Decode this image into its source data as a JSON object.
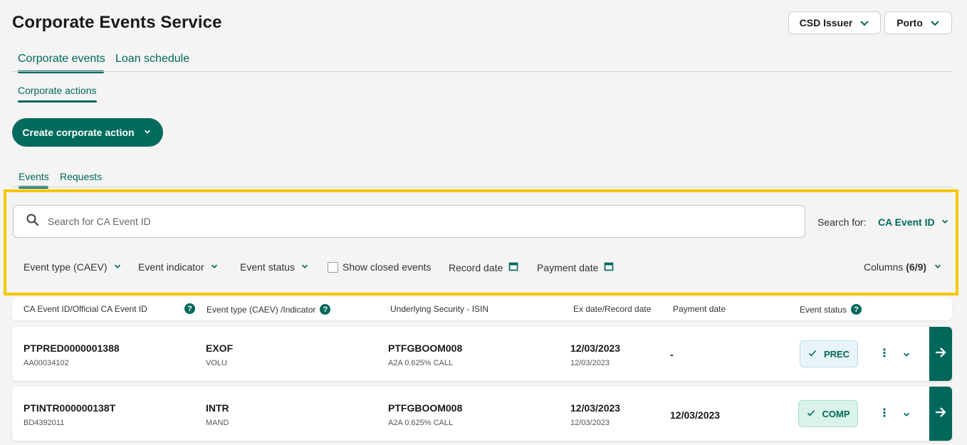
{
  "header": {
    "title": "Corporate Events Service",
    "role_selector": "CSD Issuer",
    "location_selector": "Porto"
  },
  "main_tabs": [
    {
      "label": "Corporate events",
      "active": true
    },
    {
      "label": "Loan schedule",
      "active": false
    }
  ],
  "sub_tab": {
    "label": "Corporate actions",
    "active": true
  },
  "create_button": "Create corporate action",
  "content_tabs": [
    {
      "label": "Events",
      "active": true
    },
    {
      "label": "Requests",
      "active": false
    }
  ],
  "search": {
    "placeholder": "Search for CA Event ID",
    "search_for_label": "Search for:",
    "search_for_value": "CA Event ID"
  },
  "filters": {
    "event_type": "Event type (CAEV)",
    "event_indicator": "Event indicator",
    "event_status": "Event status",
    "show_closed": "Show closed events",
    "record_date": "Record date",
    "payment_date": "Payment date",
    "columns_label": "Columns",
    "columns_count": "(6/9)"
  },
  "table": {
    "headers": {
      "id": "CA Event ID/Official CA Event ID",
      "type": "Event type (CAEV) /Indicator",
      "security": "Underlying Security - ISIN",
      "exdate": "Ex date/Record date",
      "payment": "Payment date",
      "status": "Event status"
    },
    "rows": [
      {
        "id": "PTPRED0000001388",
        "official_id": "AA00034102",
        "type": "EXOF",
        "indicator": "VOLU",
        "isin": "PTFGBOOM008",
        "security": "A2A 0.625% CALL",
        "ex_date": "12/03/2023",
        "record_date": "12/03/2023",
        "payment_date": "-",
        "status": "PREC"
      },
      {
        "id": "PTINTR000000138T",
        "official_id": "BD4392011",
        "type": "INTR",
        "indicator": "MAND",
        "isin": "PTFGBOOM008",
        "security": "A2A 0.625% CALL",
        "ex_date": "12/03/2023",
        "record_date": "12/03/2023",
        "payment_date": "12/03/2023",
        "status": "COMP"
      }
    ]
  },
  "colors": {
    "accent": "#00685a",
    "highlight": "#f5c800",
    "status_prec_bg": "#e8f4f8",
    "status_comp_bg": "#d9f3ea"
  }
}
